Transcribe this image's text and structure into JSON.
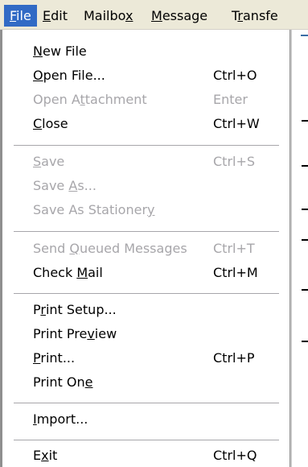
{
  "menubar": {
    "items": [
      {
        "pre": "",
        "key": "F",
        "post": "ile"
      },
      {
        "pre": "",
        "key": "E",
        "post": "dit"
      },
      {
        "pre": "Mailbo",
        "key": "x",
        "post": ""
      },
      {
        "pre": "",
        "key": "M",
        "post": "essage"
      },
      {
        "pre": "T",
        "key": "r",
        "post": "ansfe"
      }
    ],
    "active_index": 0,
    "active_bg": "#316ac5"
  },
  "file_menu": {
    "items": [
      {
        "pre": "",
        "key": "N",
        "post": "ew File",
        "shortcut": "",
        "disabled": false
      },
      {
        "pre": "",
        "key": "O",
        "post": "pen File...",
        "shortcut": "Ctrl+O",
        "disabled": false
      },
      {
        "pre": "Open A",
        "key": "t",
        "post": "tachment",
        "shortcut": "Enter",
        "disabled": true
      },
      {
        "pre": "",
        "key": "C",
        "post": "lose",
        "shortcut": "Ctrl+W",
        "disabled": false
      },
      {
        "pre": "",
        "key": "S",
        "post": "ave",
        "shortcut": "Ctrl+S",
        "disabled": true
      },
      {
        "pre": "Save ",
        "key": "A",
        "post": "s...",
        "shortcut": "",
        "disabled": true
      },
      {
        "pre": "Save As Stationer",
        "key": "y",
        "post": "",
        "shortcut": "",
        "disabled": true
      },
      {
        "pre": "Send ",
        "key": "Q",
        "post": "ueued Messages",
        "shortcut": "Ctrl+T",
        "disabled": true
      },
      {
        "pre": "Check ",
        "key": "M",
        "post": "ail",
        "shortcut": "Ctrl+M",
        "disabled": false
      },
      {
        "pre": "P",
        "key": "r",
        "post": "int Setup...",
        "shortcut": "",
        "disabled": false
      },
      {
        "pre": "Print Pre",
        "key": "v",
        "post": "iew",
        "shortcut": "",
        "disabled": false
      },
      {
        "pre": "",
        "key": "P",
        "post": "rint...",
        "shortcut": "Ctrl+P",
        "disabled": false
      },
      {
        "pre": "Print On",
        "key": "e",
        "post": "",
        "shortcut": "",
        "disabled": false
      },
      {
        "pre": "",
        "key": "I",
        "post": "mport...",
        "shortcut": "",
        "disabled": false
      },
      {
        "pre": "E",
        "key": "x",
        "post": "it",
        "shortcut": "Ctrl+Q",
        "disabled": false
      }
    ]
  },
  "colors": {
    "menubar_bg": "#ece9d8",
    "disabled_text": "#a7a6aa",
    "separator": "#a7a6aa"
  }
}
